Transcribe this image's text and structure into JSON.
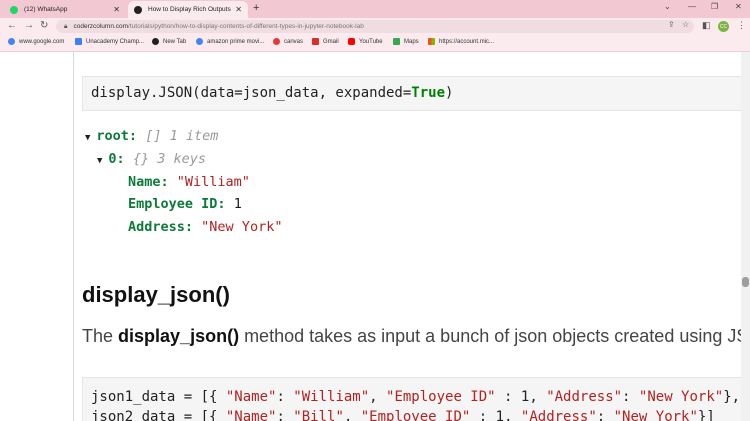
{
  "browser": {
    "tabs": [
      {
        "title": "(12) WhatsApp",
        "active": false
      },
      {
        "title": "How to Display Rich Outputs (in",
        "active": true
      }
    ],
    "new_tab_symbol": "+",
    "url_host": "coderzcolumn.com",
    "url_path": "/tutorials/python/how-to-display-contents-of-different-types-in-jupyter-notebook-lab",
    "profile_initials": "CC",
    "bookmarks": [
      {
        "label": "www.google.com",
        "icon": "google-icon",
        "color": "#4285f4"
      },
      {
        "label": "Unacademy Champ...",
        "icon": "unacademy-icon",
        "color": "#3b82f6"
      },
      {
        "label": "New Tab",
        "icon": "github-icon",
        "color": "#222222"
      },
      {
        "label": "amazon prime movi...",
        "icon": "google-icon",
        "color": "#4285f4"
      },
      {
        "label": "canvas",
        "icon": "canvas-icon",
        "color": "#e53935"
      },
      {
        "label": "Gmail",
        "icon": "gmail-icon",
        "color": "#d93025"
      },
      {
        "label": "YouTube",
        "icon": "youtube-icon",
        "color": "#ff0000"
      },
      {
        "label": "Maps",
        "icon": "maps-icon",
        "color": "#34a853"
      },
      {
        "label": "https://account.mic...",
        "icon": "microsoft-icon",
        "color": "#f25022"
      }
    ]
  },
  "content": {
    "code1": {
      "prefix": "display.JSON(data=json_data, expanded=",
      "keyword": "True",
      "suffix": ")"
    },
    "tree": {
      "root_key": "root:",
      "root_meta": "[] 1 item",
      "item_key": "0:",
      "item_meta": "{} 3 keys",
      "fields": [
        {
          "key": "Name:",
          "value": "\"William\"",
          "kind": "string"
        },
        {
          "key": "Employee ID:",
          "value": "1",
          "kind": "number"
        },
        {
          "key": "Address:",
          "value": "\"New York\"",
          "kind": "string"
        }
      ]
    },
    "heading": "display_json()",
    "paragraph": {
      "before": "The ",
      "bold": "display_json()",
      "after": " method takes as input a bunch of json objects created using JSON c"
    },
    "code2_lines": [
      {
        "var": "json1_data = [{ ",
        "name_key": "\"Name\"",
        "name_val": "\"William\"",
        "emp_key": "\"Employee ID\"",
        "emp_val": "1",
        "addr_key": "\"Address\"",
        "addr_val": "\"New York\"",
        "end": "},"
      },
      {
        "var": "json2_data = [{ ",
        "name_key": "\"Name\"",
        "name_val": "\"Bill\"",
        "emp_key": "\"Employee ID\"",
        "emp_val": "1",
        "addr_key": "\"Address\"",
        "addr_val": "\"New York\"",
        "end": "}]"
      }
    ]
  }
}
